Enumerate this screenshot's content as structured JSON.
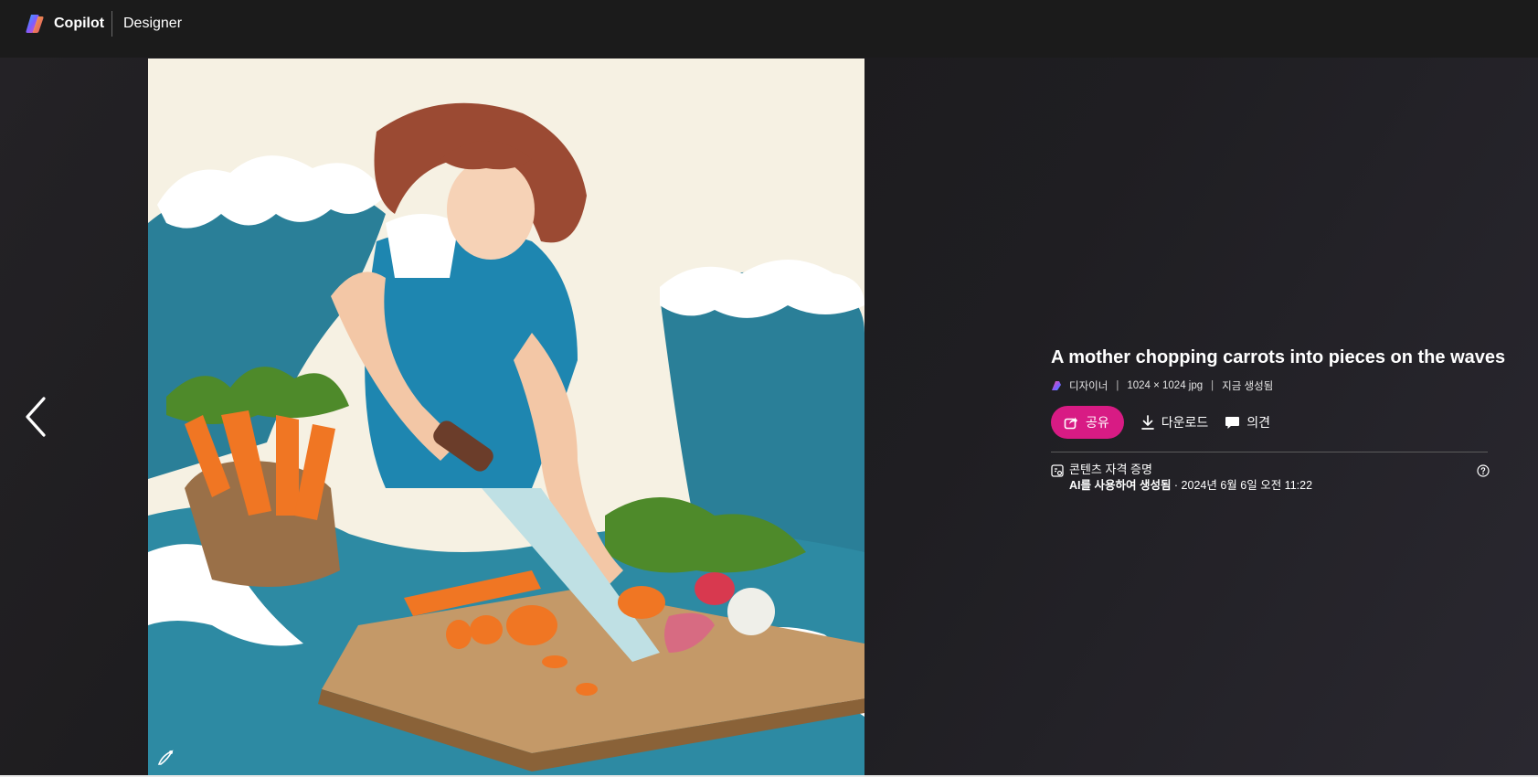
{
  "header": {
    "brand": "Copilot",
    "product": "Designer"
  },
  "navigation": {
    "prev_icon": "chevron-left-icon"
  },
  "image": {
    "alt": "A mother chopping carrots into pieces on the waves",
    "watermark_icon": "designer-watermark-icon"
  },
  "details": {
    "title": "A mother chopping carrots into pieces on the waves",
    "meta": {
      "app": "디자이너",
      "size": "1024 × 1024 jpg",
      "status": "지금 생성됨"
    },
    "actions": {
      "share": "공유",
      "download": "다운로드",
      "feedback": "의견"
    },
    "credentials": {
      "title": "콘텐츠 자격 증명",
      "generated_with": "AI를 사용하여 생성됨",
      "timestamp": " · 2024년 6월 6일 오전 11:22"
    }
  },
  "colors": {
    "accent": "#d81b84",
    "background": "#1b1b1b"
  }
}
